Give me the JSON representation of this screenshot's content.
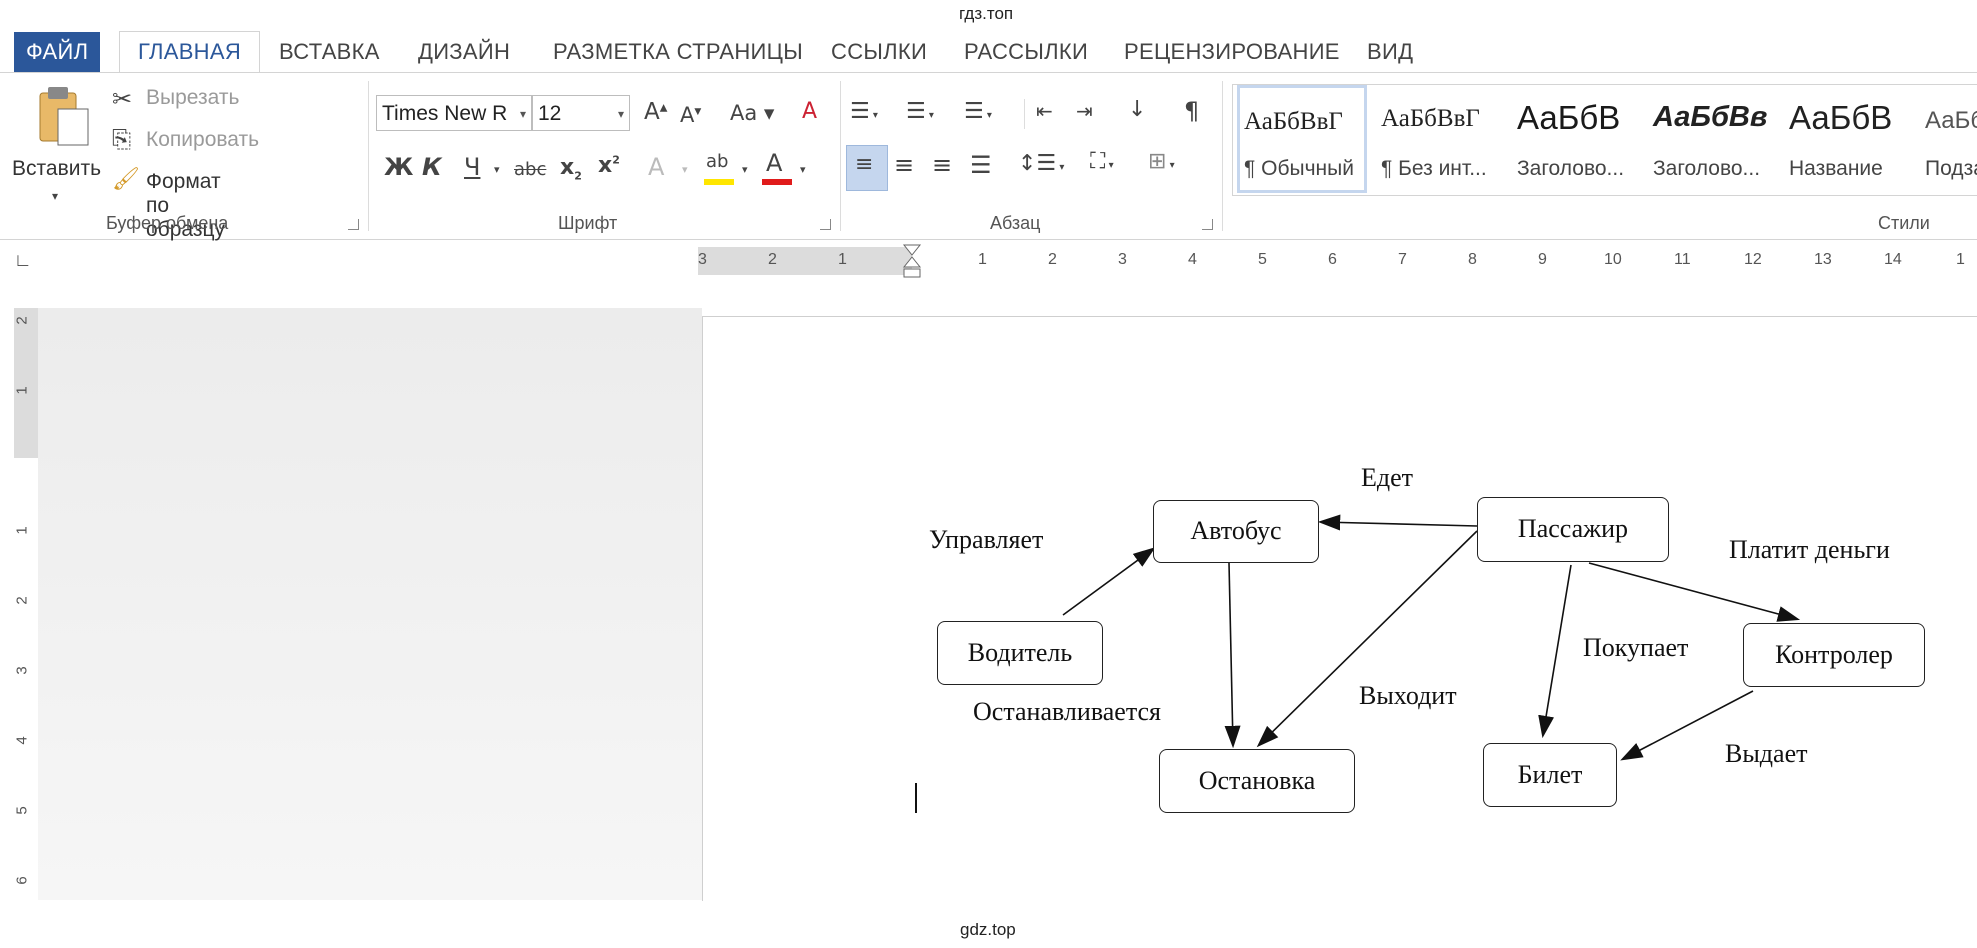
{
  "watermark": {
    "top": "гдз.топ",
    "bottom": "gdz.top"
  },
  "tabs": [
    "ФАЙЛ",
    "ГЛАВНАЯ",
    "ВСТАВКА",
    "ДИЗАЙН",
    "РАЗМЕТКА СТРАНИЦЫ",
    "ССЫЛКИ",
    "РАССЫЛКИ",
    "РЕЦЕНЗИРОВАНИЕ",
    "ВИД"
  ],
  "clipboard": {
    "paste": "Вставить",
    "cut": "Вырезать",
    "copy": "Копировать",
    "format_painter": "Формат по образцу",
    "group_label": "Буфер обмена"
  },
  "font": {
    "name": "Times New R",
    "size": "12",
    "group_label": "Шрифт",
    "bold": "Ж",
    "italic": "К",
    "underline": "Ч",
    "strike": "abc",
    "change_case": "Aa"
  },
  "paragraph": {
    "group_label": "Абзац"
  },
  "styles": {
    "group_label": "Стили",
    "items": [
      {
        "preview": "АаБбВвГ",
        "name": "¶ Обычный"
      },
      {
        "preview": "АаБбВвГ",
        "name": "¶ Без инт..."
      },
      {
        "preview": "АаБбВ",
        "name": "Заголово..."
      },
      {
        "preview": "АаБбВв",
        "name": "Заголово..."
      },
      {
        "preview": "АаБбВ",
        "name": "Название"
      },
      {
        "preview": "АаБб",
        "name": "Подза"
      }
    ]
  },
  "ruler": {
    "h_left": [
      "3",
      "2",
      "1"
    ],
    "h_right": [
      "1",
      "2",
      "3",
      "4",
      "5",
      "6",
      "7",
      "8",
      "9",
      "10",
      "11",
      "12",
      "13",
      "14",
      "1"
    ],
    "v_top": [
      "2",
      "1"
    ],
    "v_bottom": [
      "1",
      "2",
      "3",
      "4",
      "5",
      "6"
    ]
  },
  "diagram": {
    "nodes": {
      "bus": "Автобус",
      "passenger": "Пассажир",
      "driver": "Водитель",
      "controller": "Контролер",
      "stop": "Остановка",
      "ticket": "Билет"
    },
    "labels": {
      "drives": "Едет",
      "controls": "Управляет",
      "pays": "Платит деньги",
      "buys": "Покупает",
      "stops": "Останавливается",
      "exits": "Выходит",
      "issues": "Выдает"
    }
  }
}
